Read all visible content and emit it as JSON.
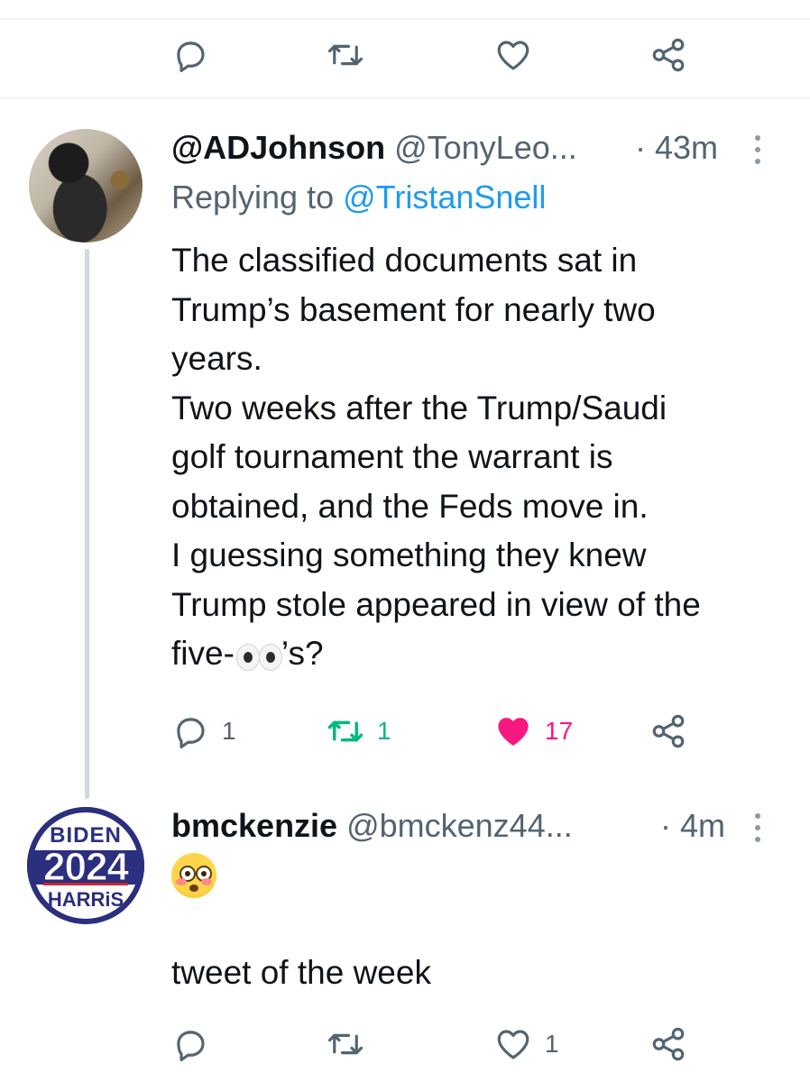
{
  "top_action_bar": {
    "reply_count": "",
    "retweet_count": "",
    "like_count": ""
  },
  "tweet1": {
    "display_name": "@ADJohnson",
    "handle": "@TonyLeo...",
    "time": "· 43m",
    "replying_label": "Replying to",
    "replying_to": "@TristanSnell",
    "lines": [
      "The classified documents sat in",
      "Trump’s basement for nearly two",
      "years.",
      "Two weeks after the Trump/Saudi",
      "golf tournament the warrant is",
      "obtained, and the Feds move in.",
      "I guessing something they knew",
      "Trump stole appeared in view of the"
    ],
    "last_line_prefix": "five-",
    "last_line_suffix": "’s?",
    "last_line_emoji": "eyes-emoji",
    "reply_count": "1",
    "retweet_count": "1",
    "like_count": "17",
    "liked": true,
    "retweeted": true
  },
  "tweet2": {
    "display_name": "bmckenzie",
    "handle": "@bmckenz44...",
    "time": "· 4m",
    "avatar_text": {
      "top": "BIDEN",
      "middle": "2024",
      "bottom": "HARRiS"
    },
    "emoji": "flushed-face-emoji",
    "text": "tweet of the week",
    "reply_count": "",
    "retweet_count": "",
    "like_count": "1"
  },
  "colors": {
    "accent": "#1d9bf0",
    "retweet": "#00ba7c",
    "like": "#f91880",
    "muted": "#536471"
  }
}
